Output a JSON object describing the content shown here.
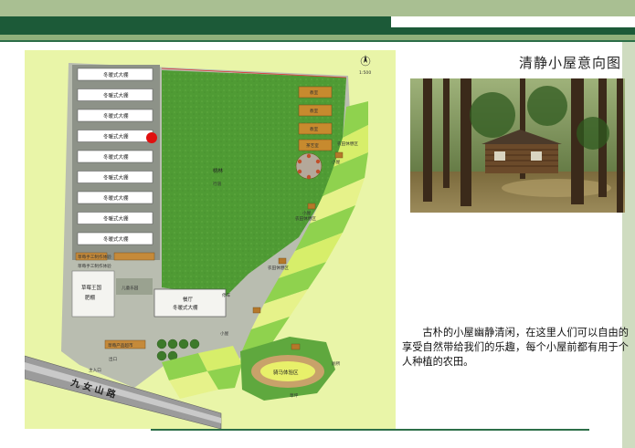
{
  "header": {
    "accent_dark": "#1c5a38",
    "accent_light": "#a9bf92"
  },
  "caption": {
    "title": "清静小屋意向图",
    "description": "古朴的小屋幽静清闲，在这里人们可以自由的享受自然带给我们的乐趣，每个小屋前都有用于个人种植的农田。"
  },
  "plan": {
    "greenhouse_label": "冬暖式大棚",
    "greenhouse_count": 9,
    "forest_label": "桃林",
    "forest_sublabel": "行道",
    "scale_text": "1:500",
    "labels": {
      "workshop_1": "草莓手工制作体验",
      "workshop_2": "草莓手工制作体验",
      "garden": "草莓王国\n肥棚",
      "play": "儿童乐园",
      "restaurant": "餐厅\n冬暖式大棚",
      "store": "草莓产品超市",
      "main_entry": "主入口",
      "exit": "出口",
      "toilet": "厕所",
      "equestrian": "骑马体验区",
      "leisure_1": "农田休憩区",
      "leisure_2": "农田休憩区",
      "leisure_3": "农田休憩区",
      "leisure_4": "农田休憩区",
      "cottage_1": "教室",
      "cottage_2": "教室",
      "cottage_3": "教室",
      "cottage_4": "茶艺室",
      "cabin_a": "小屋",
      "cabin_b": "小屋",
      "cabin_c": "小屋",
      "parking": "停车",
      "stage": "台台",
      "lawn": "草坪"
    },
    "road_label": "九 女 山 路"
  }
}
